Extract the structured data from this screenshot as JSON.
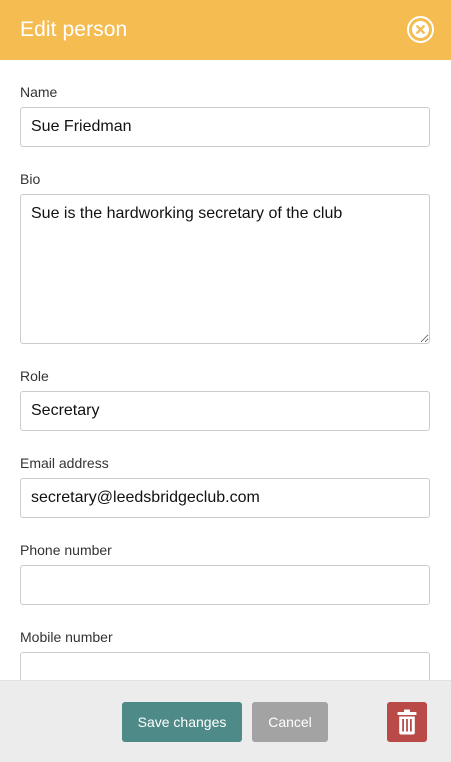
{
  "dialog": {
    "title": "Edit person",
    "close_icon": "close-circle-icon"
  },
  "fields": {
    "name": {
      "label": "Name",
      "value": "Sue Friedman"
    },
    "bio": {
      "label": "Bio",
      "value": "Sue is the hardworking secretary of the club"
    },
    "role": {
      "label": "Role",
      "value": "Secretary"
    },
    "email": {
      "label": "Email address",
      "value": "secretary@leedsbridgeclub.com"
    },
    "phone": {
      "label": "Phone number",
      "value": ""
    },
    "mobile": {
      "label": "Mobile number",
      "value": ""
    }
  },
  "footer": {
    "save_label": "Save changes",
    "cancel_label": "Cancel",
    "delete_icon": "trash-icon"
  },
  "colors": {
    "header": "#f5bc52",
    "save": "#4e8a87",
    "cancel": "#a3a3a3",
    "delete": "#b94a48"
  }
}
